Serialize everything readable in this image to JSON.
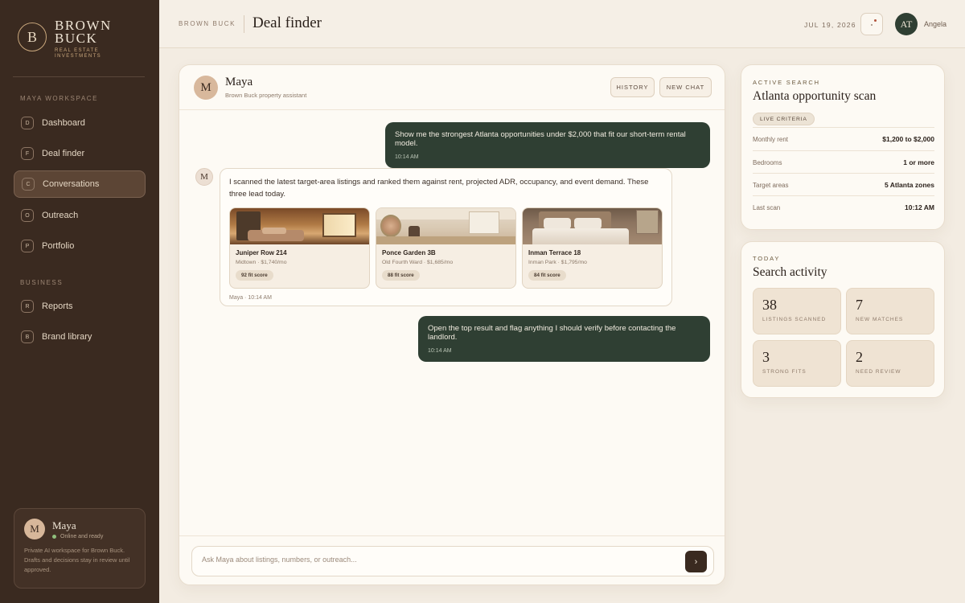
{
  "brand": {
    "mark": "B",
    "name_line1": "BROWN",
    "name_line2": "BUCK",
    "sub_line1": "REAL ESTATE",
    "sub_line2": "INVESTMENTS"
  },
  "sidebar": {
    "section_workspace": "MAYA WORKSPACE",
    "section_business": "BUSINESS",
    "items": [
      {
        "badge": "D",
        "label": "Dashboard"
      },
      {
        "badge": "F",
        "label": "Deal finder"
      },
      {
        "badge": "C",
        "label": "Conversations",
        "active": true
      },
      {
        "badge": "O",
        "label": "Outreach"
      },
      {
        "badge": "P",
        "label": "Portfolio"
      },
      {
        "badge": "R",
        "label": "Reports"
      },
      {
        "badge": "B",
        "label": "Brand library"
      }
    ],
    "assistant_card": {
      "avatar": "M",
      "name": "Maya",
      "status": "Online and ready",
      "description": "Private AI workspace for Brown Buck. Drafts and decisions stay in review until approved."
    }
  },
  "header": {
    "brand": "BROWN BUCK",
    "title": "Deal finder",
    "date": "JUL 19, 2026",
    "avatar_initials": "AT",
    "user_name": "Angela"
  },
  "chat": {
    "assistant_avatar": "M",
    "assistant_name": "Maya",
    "assistant_subtitle": "Brown Buck property assistant",
    "history_label": "HISTORY",
    "new_chat_label": "NEW CHAT",
    "messages": [
      {
        "role": "user",
        "text": "Show me the strongest Atlanta opportunities under $2,000 that fit our short-term rental model.",
        "time": "10:14 AM"
      },
      {
        "role": "assistant",
        "text": "I scanned the latest target-area listings and ranked them against rent, projected ADR, occupancy, and event demand. These three lead today.",
        "time": "Maya · 10:14 AM",
        "listings": [
          {
            "name": "Juniper Row 214",
            "meta": "Midtown · $1,740/mo",
            "score": "92 fit score"
          },
          {
            "name": "Ponce Garden 3B",
            "meta": "Old Fourth Ward · $1,685/mo",
            "score": "88 fit score"
          },
          {
            "name": "Inman Terrace 18",
            "meta": "Inman Park · $1,795/mo",
            "score": "84 fit score"
          }
        ]
      },
      {
        "role": "user",
        "text": "Open the top result and flag anything I should verify before contacting the landlord.",
        "time": "10:14 AM"
      }
    ],
    "composer_placeholder": "Ask Maya about listings, numbers, or outreach...",
    "send_icon": "›"
  },
  "active_search": {
    "eyebrow": "ACTIVE SEARCH",
    "title": "Atlanta opportunity scan",
    "chip": "LIVE CRITERIA",
    "criteria": [
      {
        "key": "Monthly rent",
        "value": "$1,200 to $2,000"
      },
      {
        "key": "Bedrooms",
        "value": "1 or more"
      },
      {
        "key": "Target areas",
        "value": "5 Atlanta zones"
      },
      {
        "key": "Last scan",
        "value": "10:12 AM"
      }
    ]
  },
  "activity": {
    "eyebrow": "TODAY",
    "title": "Search activity",
    "stats": [
      {
        "value": "38",
        "label": "LISTINGS SCANNED"
      },
      {
        "value": "7",
        "label": "NEW MATCHES"
      },
      {
        "value": "3",
        "label": "STRONG FITS"
      },
      {
        "value": "2",
        "label": "NEED REVIEW"
      }
    ]
  }
}
